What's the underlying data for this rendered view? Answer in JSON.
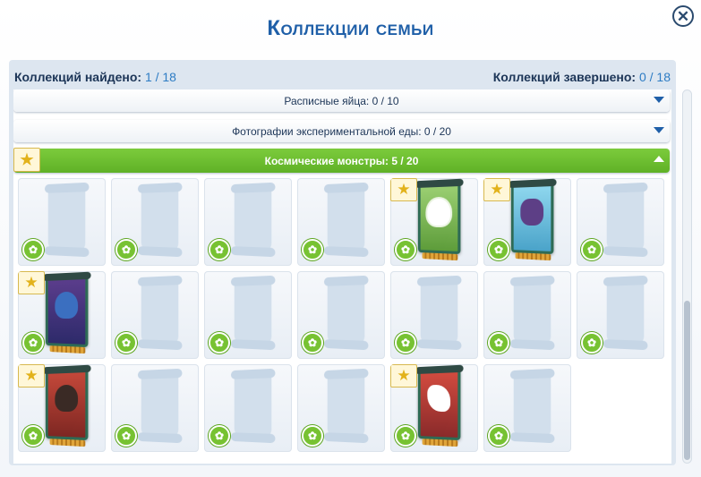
{
  "window": {
    "title": "Коллекции семьи",
    "close_glyph": "✕"
  },
  "stats": {
    "found_label": "Коллекций найдено:",
    "found_value": "1 / 18",
    "completed_label": "Коллекций завершено:",
    "completed_value": "0 / 18"
  },
  "collections": [
    {
      "label": "Расписные яйца: 0 / 10",
      "expanded": false
    },
    {
      "label": "Фотографии экспериментальной еды: 0 / 20",
      "expanded": false
    },
    {
      "label": "Космические монстры: 5 / 20",
      "expanded": true,
      "starred": true
    }
  ],
  "items": [
    {
      "collected": false
    },
    {
      "collected": false
    },
    {
      "collected": false
    },
    {
      "collected": false
    },
    {
      "collected": true,
      "poster": "poster-1"
    },
    {
      "collected": true,
      "poster": "poster-2"
    },
    {
      "collected": false
    },
    {
      "collected": true,
      "poster": "poster-3"
    },
    {
      "collected": false
    },
    {
      "collected": false
    },
    {
      "collected": false
    },
    {
      "collected": false
    },
    {
      "collected": false
    },
    {
      "collected": false
    },
    {
      "collected": true,
      "poster": "poster-4"
    },
    {
      "collected": false
    },
    {
      "collected": false
    },
    {
      "collected": false
    },
    {
      "collected": true,
      "poster": "poster-5"
    },
    {
      "collected": false
    }
  ],
  "icons": {
    "star": "★",
    "reward": "✿"
  },
  "colors": {
    "title": "#1f5fa8",
    "active_header": "#6cbf2f",
    "star": "#e2b21b",
    "reward_badge": "#77c232"
  }
}
